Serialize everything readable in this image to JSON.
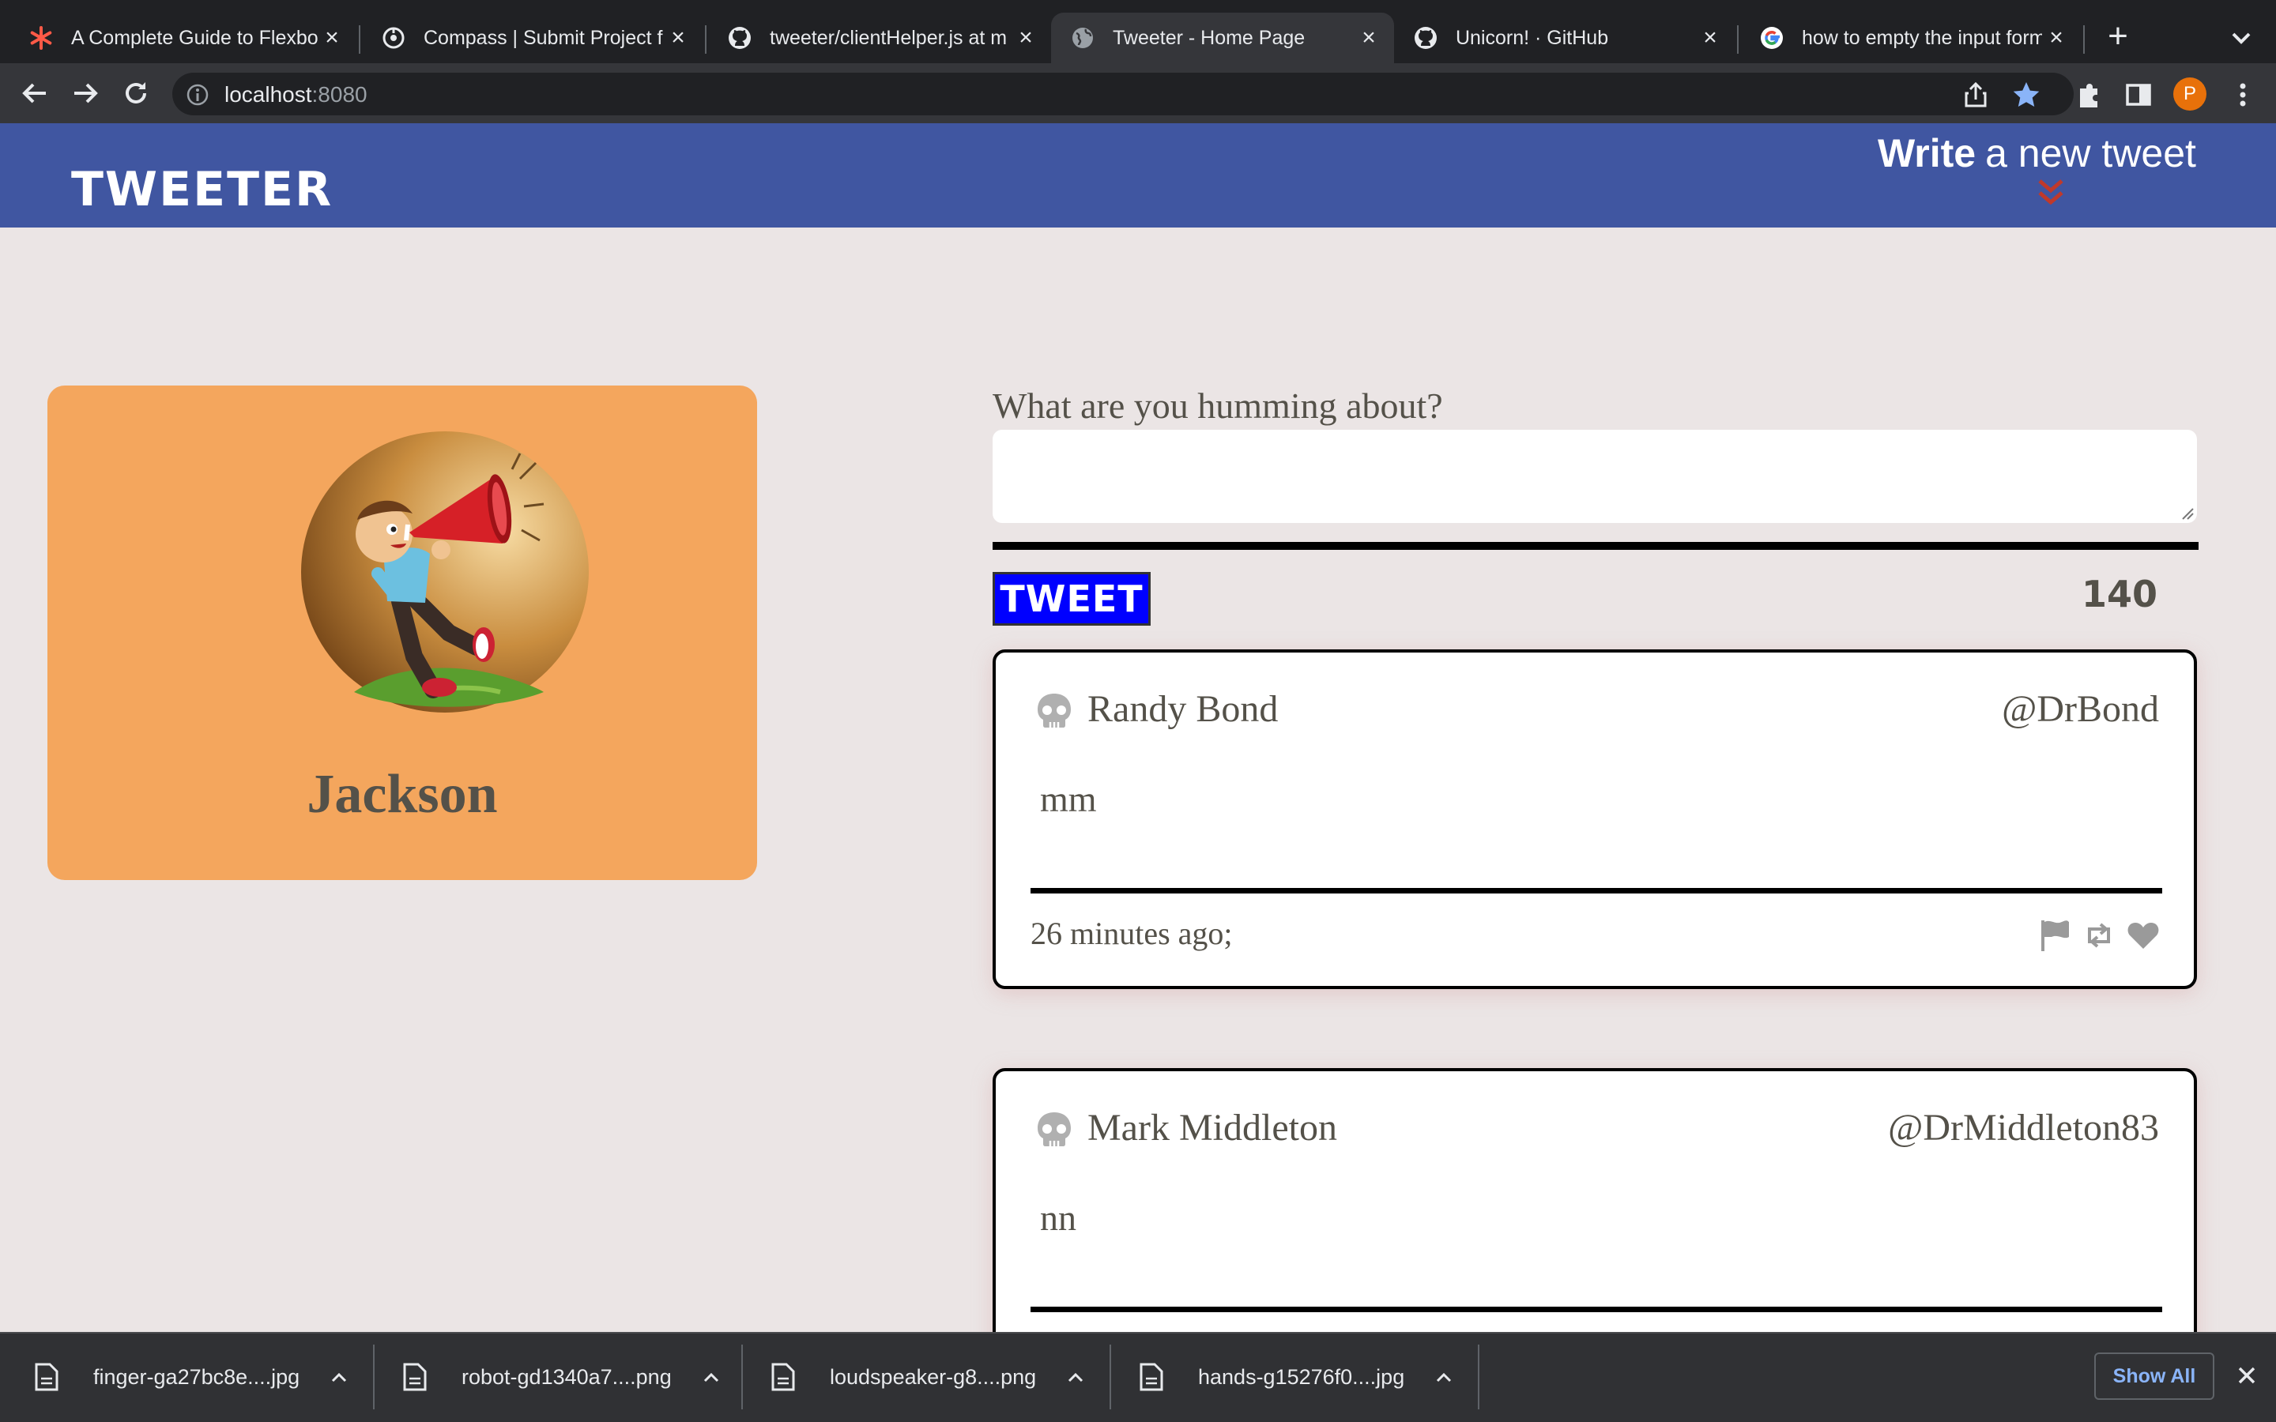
{
  "browser": {
    "tabs": [
      {
        "title": "A Complete Guide to Flexbox"
      },
      {
        "title": "Compass | Submit Project f"
      },
      {
        "title": "tweeter/clientHelper.js at m"
      },
      {
        "title": "Tweeter - Home Page",
        "active": true
      },
      {
        "title": "Unicorn! · GitHub"
      },
      {
        "title": "how to empty the input form"
      }
    ],
    "tab_close_glyph": "×",
    "new_tab_glyph": "+",
    "address_host": "localhost",
    "address_port": ":8080",
    "profile_initial": "P",
    "accent_color": "#8ab4f8"
  },
  "header": {
    "logo": "TWEETER",
    "write_bold": "Write",
    "write_rest": "a new tweet",
    "background": "#4056a1"
  },
  "profile": {
    "name": "Jackson",
    "card_color": "#f4a65d"
  },
  "compose": {
    "label": "What are you humming about?",
    "input_value": "",
    "button_label": "TWEET",
    "counter": "140"
  },
  "tweets": [
    {
      "name": "Randy Bond",
      "handle": "@DrBond",
      "body": "mm",
      "time": "26 minutes ago;"
    },
    {
      "name": "Mark Middleton",
      "handle": "@DrMiddleton83",
      "body": "nn"
    }
  ],
  "downloads": {
    "items": [
      {
        "filename": "finger-ga27bc8e....jpg"
      },
      {
        "filename": "robot-gd1340a7....png"
      },
      {
        "filename": "loudspeaker-g8....png"
      },
      {
        "filename": "hands-g15276f0....jpg"
      }
    ],
    "show_all": "Show All"
  }
}
